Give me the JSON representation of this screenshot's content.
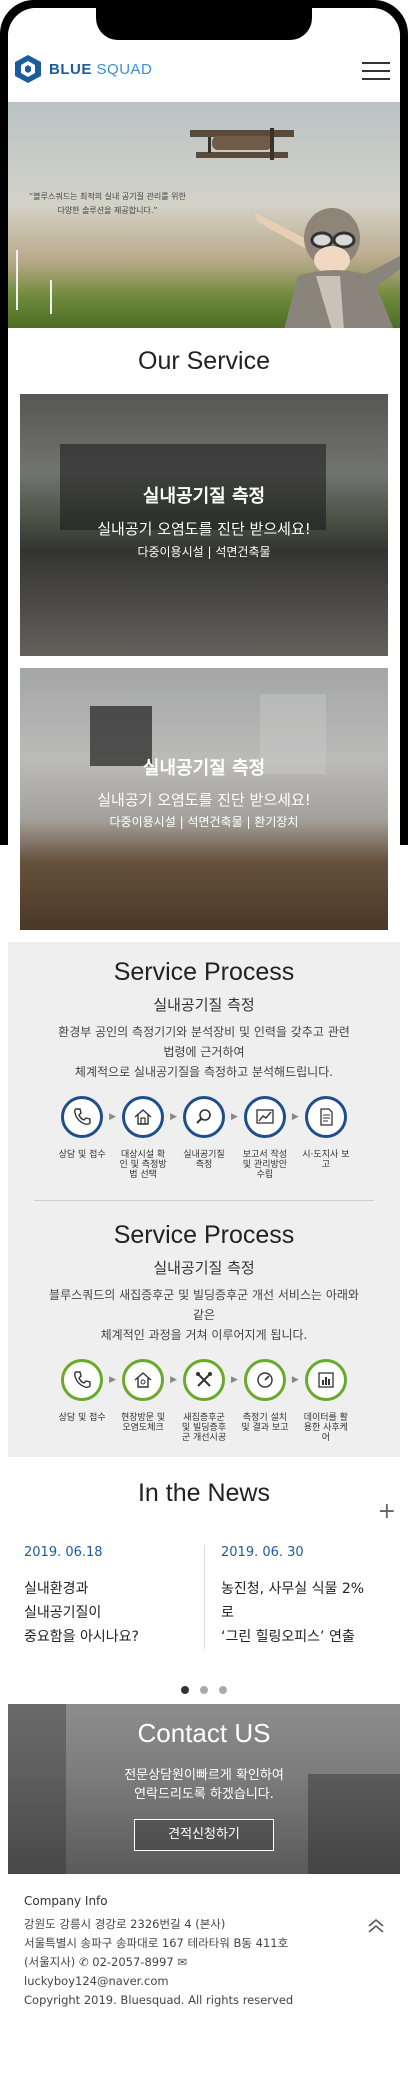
{
  "header": {
    "logo_bold": "BLUE",
    "logo_light": "SQUAD"
  },
  "hero": {
    "line1": "“블루스쿼드는 최적의 실내 공기질 관리를 위한",
    "line2": "다양한 솔루션을 제공합니다.”"
  },
  "our_service": {
    "title": "Our Service",
    "cards": [
      {
        "title": "실내공기질 측정",
        "subtitle": "실내공기 오염도를 진단 받으세요!",
        "tags": "다중이용시설 | 석면건축물"
      },
      {
        "title": "실내공기질 측정",
        "subtitle": "실내공기 오염도를 진단 받으세요!",
        "tags": "다중이용시설 | 석면건축물 | 환기장치"
      }
    ]
  },
  "process_1": {
    "title": "Service Process",
    "subtitle": "실내공기질 측정",
    "desc_line1": "환경부 공인의 측정기기와 분석장비 및 인력을 갖추고 관련",
    "desc_line2": "법령에 근거하여",
    "desc_line3": "체계적으로 실내공기질을 측정하고 분석해드립니다.",
    "steps": [
      {
        "icon": "phone-icon",
        "label": "상담 및 접수"
      },
      {
        "icon": "home-icon",
        "label": "대상시설 확인 및 측정방법 선택"
      },
      {
        "icon": "search-icon",
        "label": "실내공기질 측정"
      },
      {
        "icon": "chart-icon",
        "label": "보고서 작성 및 관리방안 수립"
      },
      {
        "icon": "document-icon",
        "label": "시·도지사 보고"
      }
    ],
    "accent": "#1f4e8c"
  },
  "process_2": {
    "title": "Service Process",
    "subtitle": "실내공기질 측정",
    "desc_line1": "블루스쿼드의 새집증후군 및 빌딩증후군 개선 서비스는 아래와",
    "desc_line2": "같은",
    "desc_line3": "체계적인 과정을 거쳐 이루어지게 됩니다.",
    "steps": [
      {
        "icon": "phone-icon",
        "label": "상담 및 접수"
      },
      {
        "icon": "home-icon",
        "label": "현장방문 및 오염도체크"
      },
      {
        "icon": "tools-icon",
        "label": "새집증후군 및 빌딩증후군 개선시공"
      },
      {
        "icon": "gauge-icon",
        "label": "측정기 설치 및 결과 보고"
      },
      {
        "icon": "data-icon",
        "label": "데이터를 활용한 사후케어"
      }
    ],
    "accent": "#69a92c"
  },
  "news": {
    "title": "In the News",
    "more": "+",
    "items": [
      {
        "date": "2019. 06.18",
        "line1": "실내환경과",
        "line2": "실내공기질이",
        "line3": "중요함을 아시나요?"
      },
      {
        "date": "2019. 06. 30",
        "line1": "농진청, 사무실 식물 2%",
        "line2": "로",
        "line3": "‘그린 힐링오피스’ 연출"
      }
    ]
  },
  "contact": {
    "title": "Contact US",
    "desc_line1": "전문상담원이빠르게 확인하여",
    "desc_line2": "연락드리도록 하겠습니다.",
    "button": "견적신청하기"
  },
  "footer": {
    "title": "Company Info",
    "address1": "강원도 강릉시 경강로 2326번길 4 (본사)",
    "address2": "서울특별시 송파구 송파대로 167 테라타워 B동 411호",
    "branch": "(서울지사)",
    "phone": "02-2057-8997",
    "email": "luckyboy124@naver.com",
    "copyright": "Copyright 2019. Bluesquad. All rights reserved"
  }
}
